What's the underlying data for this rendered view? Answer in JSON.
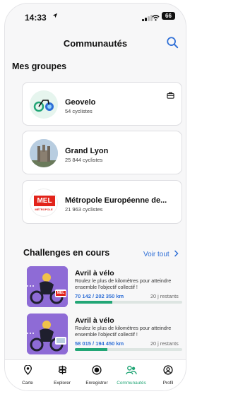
{
  "status_bar": {
    "time": "14:33",
    "battery": "66"
  },
  "header": {
    "title": "Communautés"
  },
  "groups": {
    "title": "Mes groupes",
    "items": [
      {
        "name": "Geovelo",
        "meta": "54 cyclistes"
      },
      {
        "name": "Grand Lyon",
        "meta": "25 844 cyclistes"
      },
      {
        "name": "Métropole Européenne de...",
        "meta": "21 963 cyclistes",
        "logo_text": "MEL",
        "logo_subtext": "MÉTROPOLE"
      }
    ]
  },
  "challenges": {
    "title": "Challenges en cours",
    "see_all": "Voir tout",
    "items": [
      {
        "title": "Avril à vélo",
        "description": "Roulez le plus de kilomètres pour atteindre ensemble l'objectif collectif !",
        "progress": "70 142 / 202 350 km",
        "progress_fraction": 0.35,
        "days_left": "20 j restants",
        "badge_text": "MEL"
      },
      {
        "title": "Avril à vélo",
        "description": "Roulez le plus de kilomètres pour atteindre ensemble l'objectif collectif !",
        "progress": "58 015 / 194 450 km",
        "progress_fraction": 0.3,
        "days_left": "20 j restants",
        "badge_text": ""
      }
    ]
  },
  "nav": {
    "items": [
      {
        "label": "Carte",
        "icon": "map-pin-icon"
      },
      {
        "label": "Explorer",
        "icon": "signpost-icon"
      },
      {
        "label": "Enregistrer",
        "icon": "record-icon"
      },
      {
        "label": "Communautés",
        "icon": "community-icon"
      },
      {
        "label": "Profil",
        "icon": "profile-icon"
      }
    ],
    "active": "Communautés"
  },
  "colors": {
    "accent": "#2f6fd6",
    "green": "#22a676",
    "mel_red": "#e2231a",
    "challenge_purple": "#8e6bd6"
  }
}
